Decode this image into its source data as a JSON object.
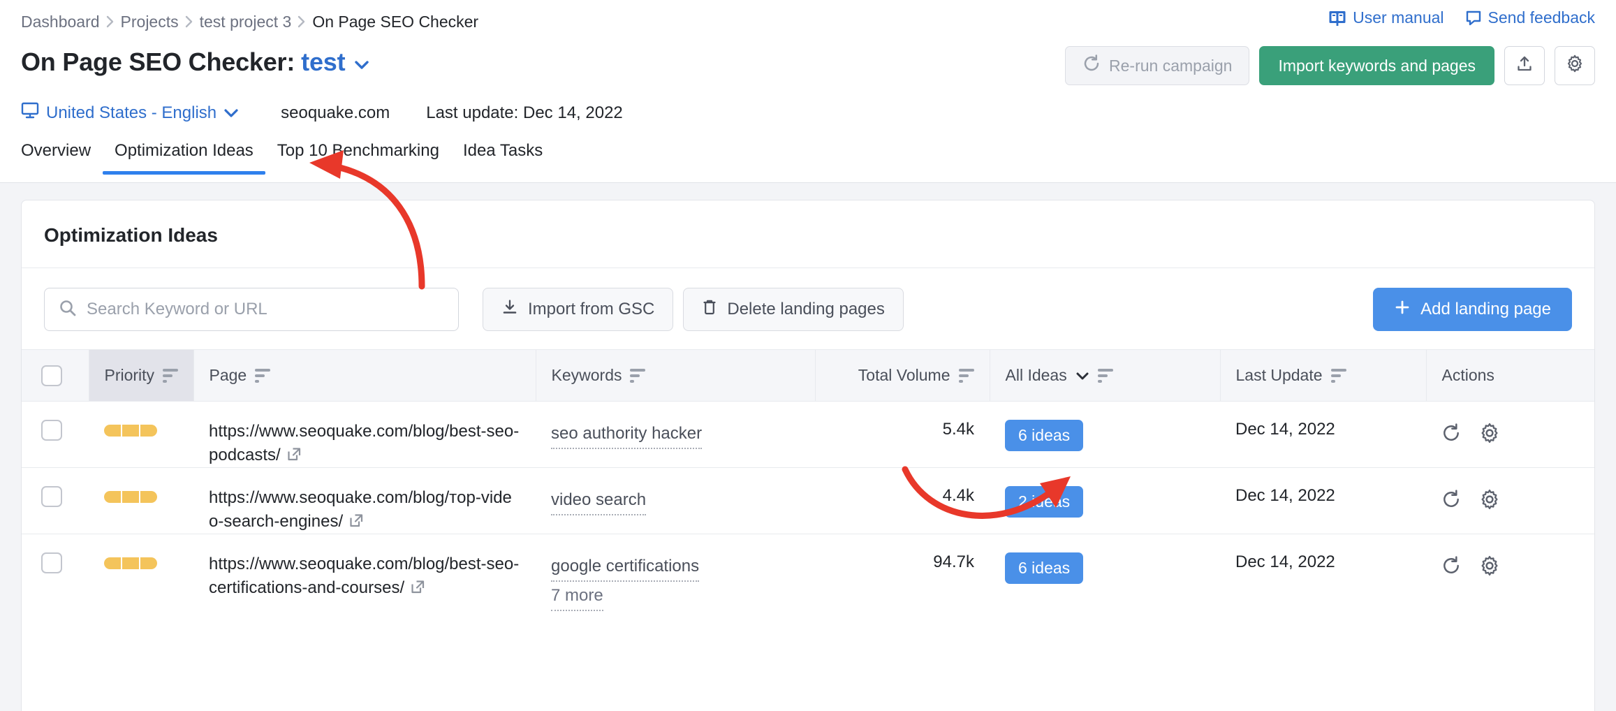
{
  "breadcrumb": {
    "items": [
      {
        "label": "Dashboard",
        "current": false
      },
      {
        "label": "Projects",
        "current": false
      },
      {
        "label": "test project 3",
        "current": false
      },
      {
        "label": "On Page SEO Checker",
        "current": true
      }
    ]
  },
  "header_links": [
    {
      "label": "User manual",
      "icon": "book-icon"
    },
    {
      "label": "Send feedback",
      "icon": "speech-bubble-icon"
    }
  ],
  "title": {
    "prefix": "On Page SEO Checker:",
    "project": "test",
    "caret": "chevron-down-icon"
  },
  "title_actions": {
    "rerun_label": "Re-run campaign",
    "import_label": "Import keywords and pages",
    "export_icon": "upload-icon",
    "settings_icon": "gear-icon"
  },
  "meta": {
    "location": "United States - English",
    "location_icon": "monitor-icon",
    "domain": "seoquake.com",
    "last_update": "Last update: Dec 14, 2022"
  },
  "tabs": [
    {
      "label": "Overview",
      "active": false
    },
    {
      "label": "Optimization Ideas",
      "active": true
    },
    {
      "label": "Top 10 Benchmarking",
      "active": false
    },
    {
      "label": "Idea Tasks",
      "active": false
    }
  ],
  "card": {
    "title": "Optimization Ideas"
  },
  "toolbar": {
    "search_placeholder": "Search Keyword or URL",
    "search_value": "",
    "search_icon": "search-icon",
    "import_gsc_label": "Import from GSC",
    "import_gsc_icon": "download-icon",
    "delete_pages_label": "Delete landing pages",
    "delete_pages_icon": "trash-icon",
    "add_landing_page_label": "Add landing page",
    "add_landing_page_icon": "plus-icon"
  },
  "table": {
    "columns": [
      {
        "label": "Priority",
        "sortable": true,
        "sorted": true,
        "align": "left"
      },
      {
        "label": "Page",
        "sortable": true,
        "sorted": false,
        "align": "left"
      },
      {
        "label": "Keywords",
        "sortable": true,
        "sorted": false,
        "align": "left"
      },
      {
        "label": "Total Volume",
        "sortable": true,
        "sorted": false,
        "align": "right"
      },
      {
        "label": "All Ideas",
        "sortable": true,
        "sorted": false,
        "align": "left",
        "dropdown": true
      },
      {
        "label": "Last Update",
        "sortable": true,
        "sorted": false,
        "align": "left"
      },
      {
        "label": "Actions",
        "sortable": false,
        "sorted": false,
        "align": "left"
      }
    ],
    "rows": [
      {
        "checked": false,
        "priority": 3,
        "priority_max": 3,
        "url": "https://www.seoquake.com/blog/best-seo-podcasts/",
        "keywords": [
          "seo authority hacker"
        ],
        "total_volume": "5.4k",
        "ideas": "6 ideas",
        "last_update": "Dec 14, 2022",
        "actions": [
          "refresh-icon",
          "gear-icon"
        ]
      },
      {
        "checked": false,
        "priority": 3,
        "priority_max": 3,
        "url": "https://www.seoquake.com/blog/тop-video-search-engines/",
        "keywords": [
          "video search"
        ],
        "total_volume": "4.4k",
        "ideas": "2 ideas",
        "last_update": "Dec 14, 2022",
        "actions": [
          "refresh-icon",
          "gear-icon"
        ]
      },
      {
        "checked": false,
        "priority": 3,
        "priority_max": 3,
        "url": "https://www.seoquake.com/blog/best-seo-certifications-and-courses/",
        "keywords": [
          "google certifications",
          "7 more"
        ],
        "total_volume": "94.7k",
        "ideas": "6 ideas",
        "last_update": "Dec 14, 2022",
        "actions": [
          "refresh-icon",
          "gear-icon"
        ]
      }
    ]
  },
  "annotations": [
    {
      "name": "arrow-to-optimization-ideas-tab",
      "color": "#e8382a"
    },
    {
      "name": "arrow-to-ideas-badge",
      "color": "#e8382a"
    }
  ],
  "colors": {
    "accent_blue": "#4a90e8",
    "link_blue": "#2f6ecc",
    "tab_underline": "#2f80ed",
    "green": "#3aa07a",
    "priority_amber": "#f4c45b",
    "annotation_red": "#e8382a"
  }
}
